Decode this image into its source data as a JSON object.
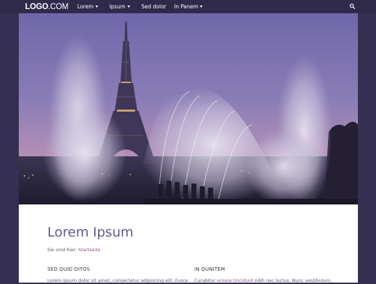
{
  "logo": {
    "bold": "LOGO",
    "light": ".COM"
  },
  "nav": {
    "items": [
      {
        "label": "Lorem"
      },
      {
        "label": "Ipsum"
      },
      {
        "label": "Sed dolor"
      },
      {
        "label": "In Panem"
      }
    ]
  },
  "page": {
    "title": "Lorem Ipsum",
    "breadcrumb_prefix": "Sie sind hier:",
    "breadcrumb_link": "Startseite"
  },
  "columns": [
    {
      "heading": "SED QUID DITOS",
      "text": "Lorem ipsum dolor sit amet, consectetur adipiscing elit. Fusce"
    },
    {
      "heading": "IN QUNITEM",
      "text_before": "Curabitur ",
      "link": "ornare tincidunt",
      "text_after": " nibh nec luctus. Nunc vestibulum,"
    }
  ],
  "colors": {
    "background": "#352f52",
    "topbar": "#2f2a4a",
    "title": "#5b5a97",
    "link": "#8a4c8d"
  }
}
